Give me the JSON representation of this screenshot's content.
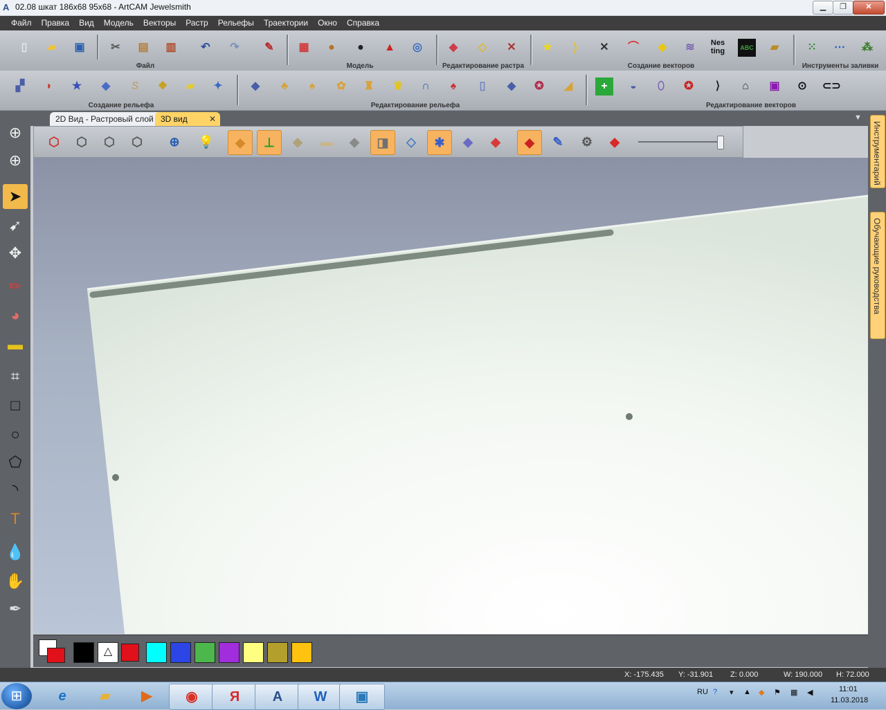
{
  "window": {
    "title": "02.08 шкат 186x68 95x68 - ArtCAM Jewelsmith"
  },
  "menu": [
    "Файл",
    "Правка",
    "Вид",
    "Модель",
    "Векторы",
    "Растр",
    "Рельефы",
    "Траектории",
    "Окно",
    "Справка"
  ],
  "toolbar_groups": {
    "file": "Файл",
    "model": "Модель",
    "raster_edit": "Редактирование растра",
    "vector_create": "Создание векторов",
    "fill_tools": "Инструменты заливки",
    "relief_create": "Создание рельефа",
    "relief_edit": "Редактирование рельефа",
    "vector_edit": "Редактирование векторов"
  },
  "tabs": {
    "tab_2d": "2D Вид - Растровый слой",
    "tab_3d": "3D вид",
    "close": "✕"
  },
  "right_tabs": {
    "tools": "Инструментарий",
    "tutorials": "Обучающие руководства"
  },
  "palette_colors": [
    "#000000",
    "#ffffff",
    "#e0111b",
    "#00ffff",
    "#2b45e6",
    "#4cb84c",
    "#a12ddc",
    "#ffff80",
    "#b3a02c",
    "#ffc20e"
  ],
  "status": {
    "x": "X: -175.435",
    "y": "Y: -31.901",
    "z": "Z: 0.000",
    "w": "W: 190.000",
    "h": "H: 72.000"
  },
  "taskbar": {
    "lang": "RU",
    "time": "11:01",
    "date": "11.03.2018"
  },
  "icons": {
    "start": "windows-orb",
    "ie": "internet-explorer-icon",
    "explorer": "file-explorer-icon",
    "media": "media-player-icon",
    "chrome": "chrome-icon",
    "yandex": "yandex-browser-icon",
    "artcam": "artcam-icon",
    "word": "word-icon",
    "photo": "photo-viewer-icon"
  },
  "taskbar_glyphs": {
    "ie": "e",
    "media": "▶",
    "yandex": "Я",
    "artcam": "A",
    "word": "W"
  }
}
